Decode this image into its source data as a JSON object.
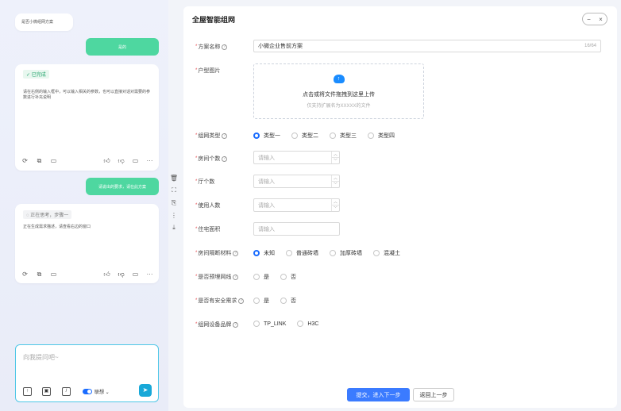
{
  "chat": {
    "msg1": "是否小微组网方案",
    "msg2_reply": "是的",
    "done_tag": "✓ 已完成",
    "done_text": "请在右侧的输入框中，可以输入相关的参数，也可以直接对话对需要的参数进行补充说明",
    "msg3_reply": "请说出的要求，请在此方案",
    "thinking_tag": "◌ 正在思考，步骤一",
    "thinking_text": "正在生成需求描述，请查看右边的窗口",
    "input_placeholder": "向我提问吧~",
    "toggle_label": "联想",
    "icons": [
      "refresh-icon",
      "copy-icon",
      "comment-icon",
      "thumbs-up-icon",
      "thumbs-down-icon",
      "more-icon",
      "upload-icon",
      "send-icon"
    ]
  },
  "panel": {
    "title": "全屋智能组网",
    "win_min": "−",
    "win_close": "×",
    "scheme_name_label": "方案名称",
    "scheme_name_value": "小微企业售前方案",
    "scheme_name_counter": "16/64",
    "floor_plan_label": "户型图片",
    "upload_text": "点击或将文件拖拽到这里上传",
    "upload_hint": "仅支持扩展名为XXXXX的文件",
    "network_type_label": "组网类型",
    "network_types": [
      "类型一",
      "类型二",
      "类型三",
      "类型四"
    ],
    "rooms_label": "房间个数",
    "halls_label": "厅个数",
    "users_label": "使用人数",
    "area_label": "住宅面积",
    "placeholder": "请输入",
    "wall_label": "房间隔断材料",
    "walls": [
      "未知",
      "普通砖墙",
      "加厚砖墙",
      "混凝土"
    ],
    "prewired_label": "是否预埋网线",
    "security_label": "是否有安全需求",
    "yes": "是",
    "no": "否",
    "brand_label": "组网设备品牌",
    "brands": [
      "TP_LINK",
      "H3C"
    ],
    "submit_label": "提交，进入下一步",
    "back_label": "返回上一步"
  },
  "colors": {
    "accent": "#3b7bff",
    "green": "#4ed7a0",
    "cyan": "#18a8d8"
  }
}
